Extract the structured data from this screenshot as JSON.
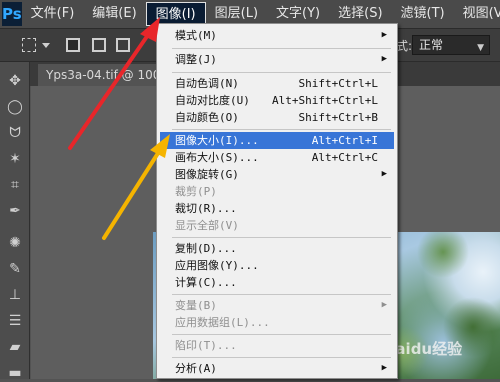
{
  "app": {
    "logo": "Ps"
  },
  "menubar": {
    "items": [
      "文件(F)",
      "编辑(E)",
      "图像(I)",
      "图层(L)",
      "文字(Y)",
      "选择(S)",
      "滤镜(T)",
      "视图(V)"
    ]
  },
  "options": {
    "style_label": "式:",
    "style_value": "正常"
  },
  "document": {
    "tab_title": "Yps3a-04.tif @ 100"
  },
  "menu": {
    "items": [
      {
        "label": "模式(M)",
        "shortcut": "",
        "submenu": true,
        "disabled": false
      },
      {
        "label": "调整(J)",
        "shortcut": "",
        "submenu": true,
        "disabled": false
      },
      {
        "label": "自动色调(N)",
        "shortcut": "Shift+Ctrl+L",
        "submenu": false,
        "disabled": false
      },
      {
        "label": "自动对比度(U)",
        "shortcut": "Alt+Shift+Ctrl+L",
        "submenu": false,
        "disabled": false
      },
      {
        "label": "自动颜色(O)",
        "shortcut": "Shift+Ctrl+B",
        "submenu": false,
        "disabled": false
      },
      {
        "label": "图像大小(I)...",
        "shortcut": "Alt+Ctrl+I",
        "submenu": false,
        "disabled": false,
        "highlighted": true
      },
      {
        "label": "画布大小(S)...",
        "shortcut": "Alt+Ctrl+C",
        "submenu": false,
        "disabled": false
      },
      {
        "label": "图像旋转(G)",
        "shortcut": "",
        "submenu": true,
        "disabled": false
      },
      {
        "label": "裁剪(P)",
        "shortcut": "",
        "submenu": false,
        "disabled": true
      },
      {
        "label": "裁切(R)...",
        "shortcut": "",
        "submenu": false,
        "disabled": false
      },
      {
        "label": "显示全部(V)",
        "shortcut": "",
        "submenu": false,
        "disabled": true
      },
      {
        "label": "复制(D)...",
        "shortcut": "",
        "submenu": false,
        "disabled": false
      },
      {
        "label": "应用图像(Y)...",
        "shortcut": "",
        "submenu": false,
        "disabled": false
      },
      {
        "label": "计算(C)...",
        "shortcut": "",
        "submenu": false,
        "disabled": false
      },
      {
        "label": "变量(B)",
        "shortcut": "",
        "submenu": true,
        "disabled": true
      },
      {
        "label": "应用数据组(L)...",
        "shortcut": "",
        "submenu": false,
        "disabled": true
      },
      {
        "label": "陷印(T)...",
        "shortcut": "",
        "submenu": false,
        "disabled": true
      },
      {
        "label": "分析(A)",
        "shortcut": "",
        "submenu": true,
        "disabled": false
      }
    ]
  },
  "colors": {
    "highlight": "#3875d7",
    "arrow_red": "#e8262a",
    "arrow_yellow": "#f5b400"
  },
  "watermark": "Baidu经验"
}
